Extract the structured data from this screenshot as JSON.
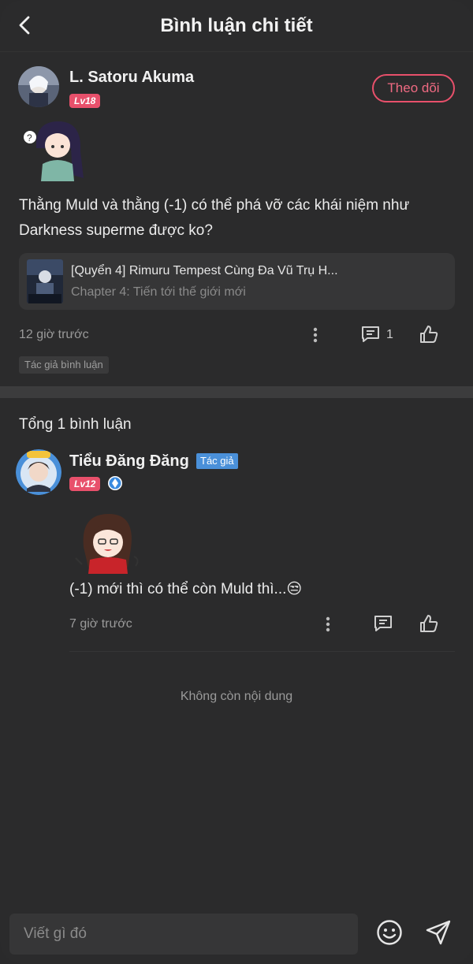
{
  "header": {
    "title": "Bình luận chi tiết"
  },
  "post": {
    "username": "L. Satoru Akuma",
    "level": "Lv18",
    "follow_label": "Theo dõi",
    "text": "Thằng Muld và thằng (-1) có thể phá vỡ các khái niệm như Darkness superme được ko?",
    "chapter_card": {
      "book": "[Quyển 4] Rimuru Tempest Cùng Đa Vũ Trụ H...",
      "chapter": "Chapter 4: Tiến tới thế giới mới"
    },
    "time": "12 giờ trước",
    "reply_count": "1",
    "tag": "Tác giả bình luận"
  },
  "replies": {
    "total_label": "Tổng 1 bình luận",
    "items": [
      {
        "username": "Tiểu Đăng Đăng",
        "author_tag": "Tác giả",
        "level": "Lv12",
        "text": "(-1) mới thì có thể còn Muld thì...😒",
        "time": "7 giờ trước"
      }
    ],
    "end_label": "Không còn nội dung"
  },
  "composer": {
    "placeholder": "Viết gì đó"
  },
  "colors": {
    "accent": "#e8506b",
    "author_blue": "#4a90d9",
    "background": "#2b2b2c"
  },
  "icons": [
    "back-arrow-icon",
    "more-vertical-icon",
    "comment-icon",
    "thumbs-up-icon",
    "emoji-icon",
    "send-icon",
    "diamond-badge-icon"
  ]
}
